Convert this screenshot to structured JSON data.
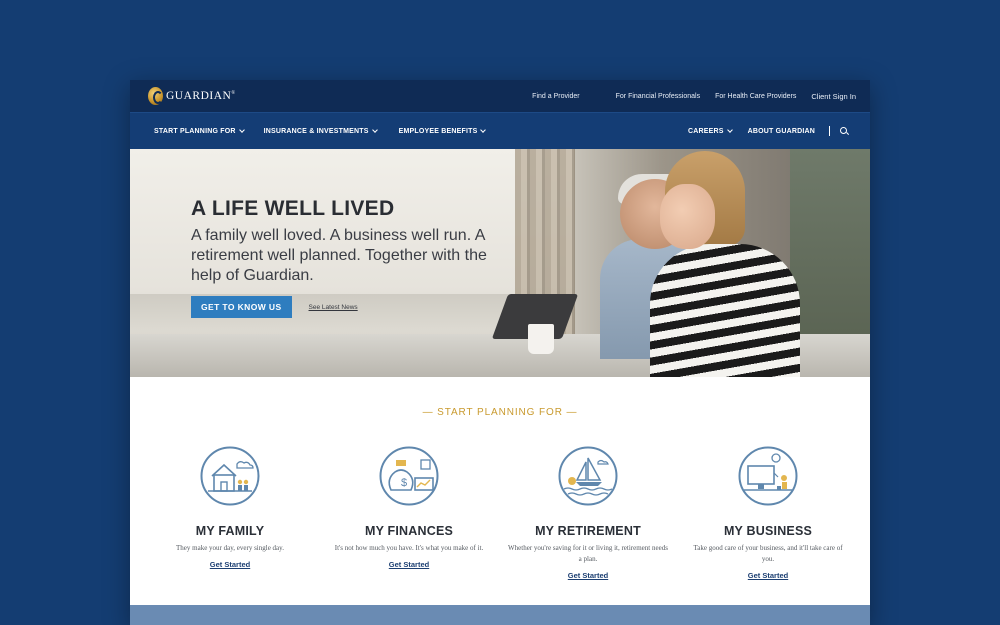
{
  "brand": {
    "name": "GUARDIAN",
    "mark": "®"
  },
  "utility_nav": [
    "Find a Provider",
    "For Financial Professionals",
    "For Health Care Providers",
    "Client Sign In"
  ],
  "main_nav": {
    "left": [
      "START PLANNING FOR",
      "INSURANCE & INVESTMENTS",
      "EMPLOYEE BENEFITS"
    ],
    "right": [
      "CAREERS",
      "ABOUT GUARDIAN"
    ],
    "separator": "|"
  },
  "hero": {
    "title": "A LIFE WELL LIVED",
    "subtitle": "A family well loved. A business well run. A retirement well planned. Together with the help of Guardian.",
    "cta_label": "GET TO KNOW US",
    "secondary_link": "See Latest News"
  },
  "planning": {
    "heading": "— START PLANNING FOR —",
    "cards": [
      {
        "title": "MY FAMILY",
        "desc": "They make your day, every single day.",
        "link": "Get Started",
        "icon": "family-house-icon"
      },
      {
        "title": "MY FINANCES",
        "desc": "It's not how much you have. It's what you make of it.",
        "link": "Get Started",
        "icon": "money-bag-icon"
      },
      {
        "title": "MY RETIREMENT",
        "desc": "Whether you're saving for it or living it, retirement needs a plan.",
        "link": "Get Started",
        "icon": "sailboat-icon"
      },
      {
        "title": "MY BUSINESS",
        "desc": "Take good care of your business, and it'll take care of you.",
        "link": "Get Started",
        "icon": "computer-desk-icon"
      }
    ]
  },
  "colors": {
    "navy": "#0f2b55",
    "nav": "#143d75",
    "accent_gold": "#c99a2e",
    "cta_blue": "#2e7dbf",
    "icon_blue": "#5f87ad"
  }
}
